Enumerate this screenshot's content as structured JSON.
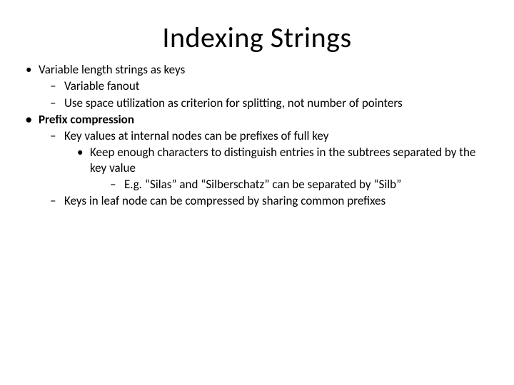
{
  "title": "Indexing Strings",
  "b1": "Variable length strings as keys",
  "b1a": "Variable fanout",
  "b1b": "Use space utilization as criterion for splitting, not number of pointers",
  "b2": "Prefix compression",
  "b2a": "Key values at internal nodes can be prefixes of full key",
  "b2a1": "Keep enough characters to distinguish entries in the subtrees separated by the key value",
  "b2a1a": "E.g. “Silas” and “Silberschatz” can be separated by “Silb”",
  "b2b": "Keys in leaf node can be compressed by sharing common prefixes"
}
